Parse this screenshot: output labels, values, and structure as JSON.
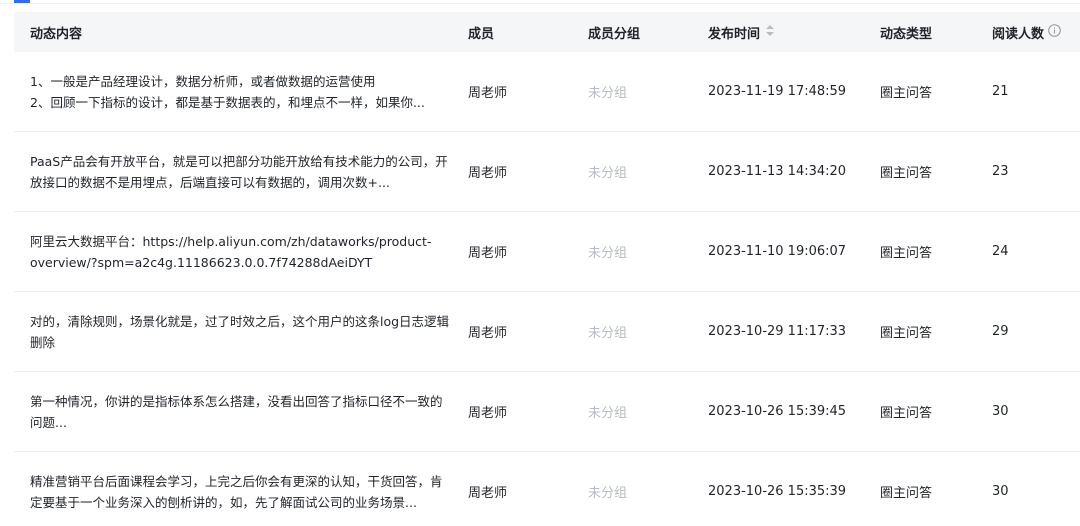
{
  "table": {
    "headers": {
      "content": "动态内容",
      "member": "成员",
      "group": "成员分组",
      "time": "发布时间",
      "type": "动态类型",
      "reads": "阅读人数"
    },
    "rows": [
      {
        "content": "1、一般是产品经理设计，数据分析师，或者做数据的运营使用\n2、回顾一下指标的设计，都是基于数据表的，和埋点不一样，如果你...",
        "member": "周老师",
        "group": "未分组",
        "time": "2023-11-19 17:48:59",
        "type": "圈主问答",
        "reads": "21"
      },
      {
        "content": "PaaS产品会有开放平台，就是可以把部分功能开放给有技术能力的公司，开放接口的数据不是用埋点，后端直接可以有数据的，调用次数+...",
        "member": "周老师",
        "group": "未分组",
        "time": "2023-11-13 14:34:20",
        "type": "圈主问答",
        "reads": "23"
      },
      {
        "content": "阿里云大数据平台：https://help.aliyun.com/zh/dataworks/product-overview/?spm=a2c4g.11186623.0.0.7f74288dAeiDYT",
        "member": "周老师",
        "group": "未分组",
        "time": "2023-11-10 19:06:07",
        "type": "圈主问答",
        "reads": "24"
      },
      {
        "content": "对的，清除规则，场景化就是，过了时效之后，这个用户的这条log日志逻辑删除",
        "member": "周老师",
        "group": "未分组",
        "time": "2023-10-29 11:17:33",
        "type": "圈主问答",
        "reads": "29"
      },
      {
        "content": "第一种情况，你讲的是指标体系怎么搭建，没看出回答了指标口径不一致的问题...",
        "member": "周老师",
        "group": "未分组",
        "time": "2023-10-26 15:39:45",
        "type": "圈主问答",
        "reads": "30"
      },
      {
        "content": "精准营销平台后面课程会学习，上完之后你会有更深的认知，干货回答，肯定要基于一个业务深入的刨析讲的，如，先了解面试公司的业务场景...",
        "member": "周老师",
        "group": "未分组",
        "time": "2023-10-26 15:35:39",
        "type": "圈主问答",
        "reads": "30"
      }
    ]
  },
  "icons": {
    "sort": "sort-icon",
    "info": "info-icon"
  },
  "colors": {
    "accent": "#2f6bff",
    "header_bg": "#f5f6f8",
    "muted": "#b8bcc4"
  }
}
